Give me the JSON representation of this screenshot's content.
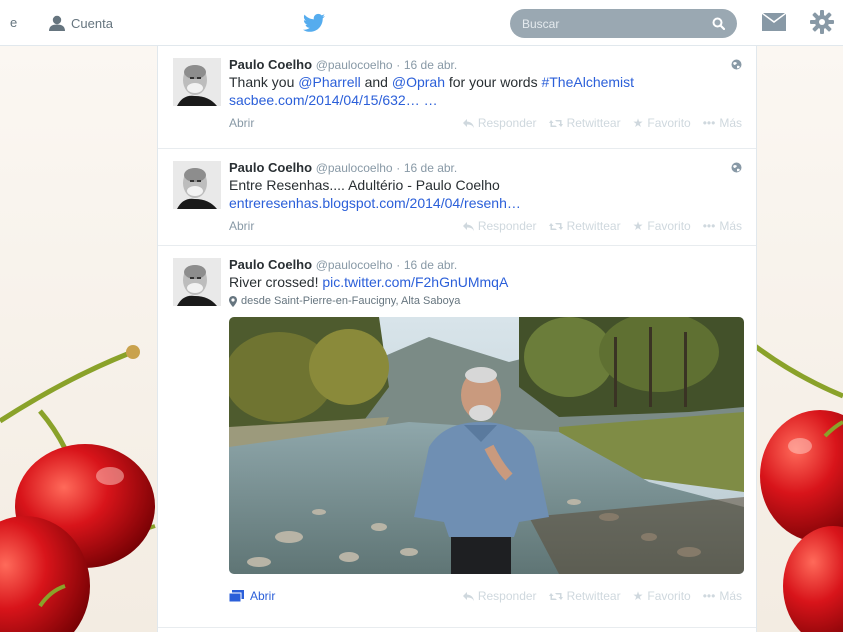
{
  "topbar": {
    "prev_fragment": "e",
    "account_label": "Cuenta",
    "search_placeholder": "Buscar"
  },
  "tweets": [
    {
      "name": "Paulo Coelho",
      "handle": "@paulocoelho",
      "dot": "·",
      "date": "16 de abr.",
      "text": {
        "p1": "Thank you ",
        "m1": "@Pharrell",
        "p2": " and ",
        "m2": "@Oprah",
        "p3": " for your words ",
        "hashtag": "#TheAlchemist"
      },
      "link": "sacbee.com/2014/04/15/632… …",
      "open_label": "Abrir"
    },
    {
      "name": "Paulo Coelho",
      "handle": "@paulocoelho",
      "dot": "·",
      "date": "16 de abr.",
      "text": "Entre Resenhas.... Adultério - Paulo Coelho",
      "link": "entreresenhas.blogspot.com/2014/04/resenh…",
      "open_label": "Abrir"
    },
    {
      "name": "Paulo Coelho",
      "handle": "@paulocoelho",
      "dot": "·",
      "date": "16 de abr.",
      "text": "River crossed! ",
      "pic_link": "pic.twitter.com/F2hGnUMmqA",
      "location": "desde Saint-Pierre-en-Faucigny, Alta Saboya",
      "open_label": "Abrir"
    }
  ],
  "actions": {
    "reply": "Responder",
    "retweet": "Retwittear",
    "favorite": "Favorito",
    "more": "Más"
  },
  "colors": {
    "link": "#2b5fd9",
    "brand_bird": "#55acee",
    "muted": "#8899a6"
  }
}
